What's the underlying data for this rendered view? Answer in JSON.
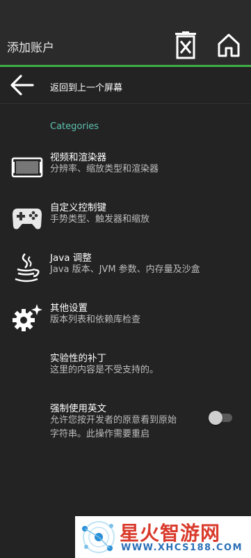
{
  "header": {
    "title": "添加账户",
    "icons": [
      "delete-icon",
      "home-icon"
    ]
  },
  "nav": {
    "back_label": "返回到上一个屏幕",
    "back_icon": "arrow-left-icon"
  },
  "section": {
    "category": "Categories"
  },
  "prefs": [
    {
      "title": "视频和渲染器",
      "summary": "分辨率、缩放类型和渲染器",
      "icon": "video-display-icon"
    },
    {
      "title": "自定义控制键",
      "summary": "手势类型、触发器和缩放",
      "icon": "gamepad-icon"
    },
    {
      "title": "Java 调整",
      "summary": "Java 版本、JVM 参数、内存量及沙盒",
      "icon": "java-cup-icon"
    },
    {
      "title": "其他设置",
      "summary": "版本列表和依赖库检查",
      "icon": "gear-sparkle-icon"
    },
    {
      "title": "实验性的补丁",
      "summary": "这里的内容是不受支持的。"
    },
    {
      "title": "强制使用英文",
      "summary_line1": "允许您按开发者的原意看到原始",
      "summary_line2": "字符串。此操作需要重启",
      "toggle_on": false
    }
  ],
  "watermark": {
    "text": "星火智游网",
    "url": "WWW.XHCS188.COM"
  },
  "colors": {
    "accent": "#3fae45",
    "category": "#5ec3b0",
    "background": "#232323"
  }
}
